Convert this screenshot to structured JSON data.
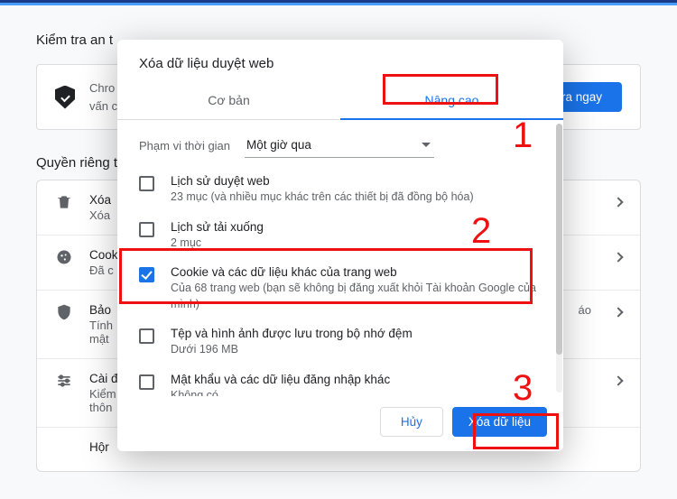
{
  "bg": {
    "heading1": "Kiểm tra an t",
    "banner_line1": "Chro",
    "banner_line2": "vấn c",
    "banner_btn": "tra ngay",
    "heading2": "Quyền riêng t",
    "rows": [
      {
        "title": "Xóa",
        "sub": "Xóa"
      },
      {
        "title": "Cook",
        "sub": "Đã c"
      },
      {
        "title": "Bảo",
        "sub": "Tính\nmật"
      },
      {
        "title": "Cài đ",
        "sub": "Kiểm\nthôn"
      },
      {
        "title": "Hộr",
        "sub": ""
      }
    ],
    "row_right": "áo"
  },
  "modal": {
    "title": "Xóa dữ liệu duyệt web",
    "tabs": {
      "basic": "Cơ bản",
      "advanced": "Nâng cao"
    },
    "time_label": "Phạm vi thời gian",
    "time_value": "Một giờ qua",
    "options": [
      {
        "title": "Lịch sử duyệt web",
        "sub": "23 mục (và nhiều mục khác trên các thiết bị đã đồng bộ hóa)",
        "checked": false
      },
      {
        "title": "Lịch sử tải xuống",
        "sub": "2 mục",
        "checked": false
      },
      {
        "title": "Cookie và các dữ liệu khác của trang web",
        "sub": "Của 68 trang web (bạn sẽ không bị đăng xuất khỏi Tài khoản Google của mình)",
        "checked": true
      },
      {
        "title": "Tệp và hình ảnh được lưu trong bộ nhớ đệm",
        "sub": "Dưới 196 MB",
        "checked": false
      },
      {
        "title": "Mật khẩu và các dữ liệu đăng nhập khác",
        "sub": "Không có",
        "checked": false
      }
    ],
    "cancel": "Hủy",
    "confirm": "Xóa dữ liệu"
  },
  "annot": {
    "n1": "1",
    "n2": "2",
    "n3": "3"
  }
}
